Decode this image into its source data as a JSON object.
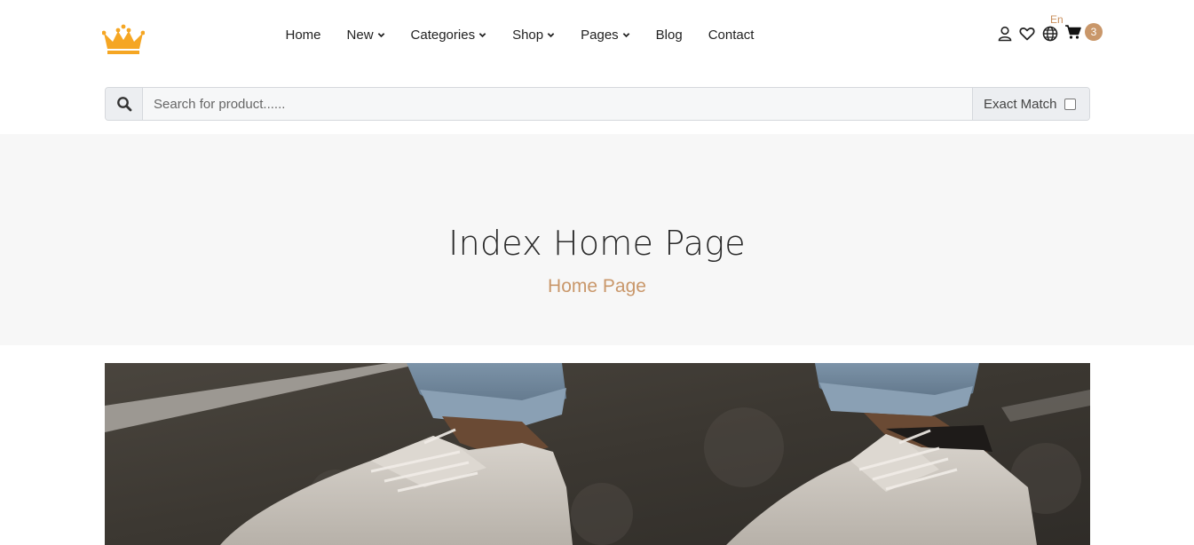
{
  "nav": {
    "items": [
      {
        "label": "Home",
        "dropdown": false
      },
      {
        "label": "New",
        "dropdown": true
      },
      {
        "label": "Categories",
        "dropdown": true
      },
      {
        "label": "Shop",
        "dropdown": true
      },
      {
        "label": "Pages",
        "dropdown": true
      },
      {
        "label": "Blog",
        "dropdown": false
      },
      {
        "label": "Contact",
        "dropdown": false
      }
    ]
  },
  "header_icons": {
    "user": "user-icon",
    "wishlist": "heart-icon",
    "language": "globe-icon",
    "language_label": "En",
    "cart": "cart-icon",
    "cart_count": "3"
  },
  "search": {
    "placeholder": "Search for product......",
    "exact_match_label": "Exact Match",
    "exact_match_checked": false
  },
  "banner": {
    "title": "Index Home Page",
    "breadcrumb": "Home Page"
  },
  "colors": {
    "accent": "#c9976a",
    "logo": "#f5a623",
    "banner_bg": "#f7f7f7"
  }
}
